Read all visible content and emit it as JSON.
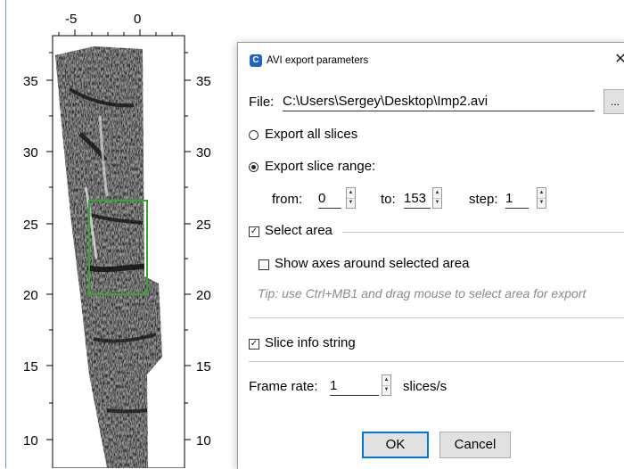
{
  "plot": {
    "x_ticks": [
      "-5",
      "0"
    ],
    "y_ticks_left": [
      "35",
      "30",
      "25",
      "20",
      "15",
      "10"
    ],
    "y_ticks_right": [
      "35",
      "30",
      "25",
      "20",
      "15",
      "10"
    ],
    "selection_color": "#3aa52e"
  },
  "dialog": {
    "title": "AVI export parameters",
    "close_label": "✕",
    "file_label": "File:",
    "file_path": "C:\\Users\\Sergey\\Desktop\\Imp2.avi",
    "browse_label": "...",
    "export_all_label": "Export all slices",
    "export_range_label": "Export slice range:",
    "export_mode": "range",
    "from_label": "from:",
    "from_value": "0",
    "to_label": "to:",
    "to_value": "153",
    "step_label": "step:",
    "step_value": "1",
    "select_area_label": "Select area",
    "select_area_checked": true,
    "show_axes_label": "Show axes around selected area",
    "show_axes_checked": false,
    "tip": "Tip: use Ctrl+MB1 and drag mouse to select area for export",
    "slice_info_label": "Slice info string",
    "slice_info_checked": true,
    "frame_rate_label": "Frame rate:",
    "frame_rate_value": "1",
    "frame_rate_unit": "slices/s",
    "ok_label": "OK",
    "cancel_label": "Cancel"
  }
}
